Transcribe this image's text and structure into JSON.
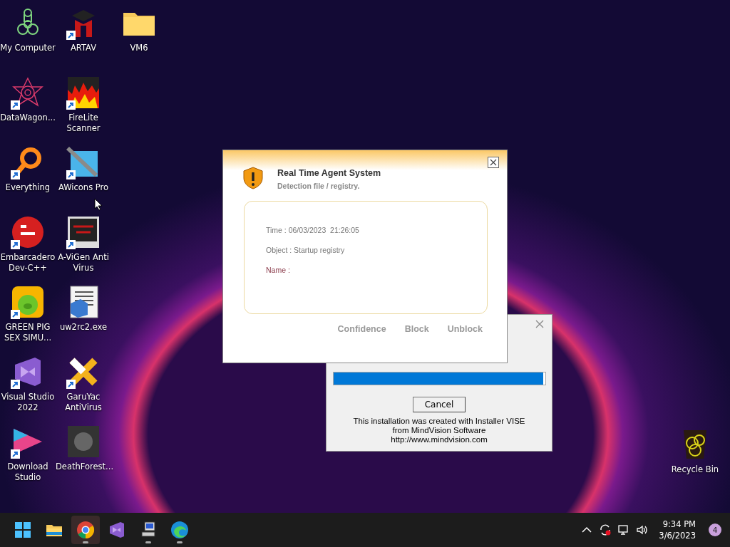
{
  "desktop_icons": [
    {
      "label": "My Computer",
      "kind": "computer",
      "shortcut": false
    },
    {
      "label": "DataWagon...",
      "kind": "star",
      "shortcut": true
    },
    {
      "label": "Everything",
      "kind": "magnifier",
      "shortcut": true
    },
    {
      "label": "Embarcadero Dev-C++",
      "kind": "devcpp",
      "shortcut": true
    },
    {
      "label": "GREEN PIG SEX SIMU...",
      "kind": "pig",
      "shortcut": true
    },
    {
      "label": "Visual Studio 2022",
      "kind": "vs",
      "shortcut": true
    },
    {
      "label": "Download Studio",
      "kind": "ds",
      "shortcut": true
    },
    {
      "label": "ARTAV",
      "kind": "cap",
      "shortcut": true
    },
    {
      "label": "FireLite Scanner",
      "kind": "fire",
      "shortcut": true
    },
    {
      "label": "AWicons Pro",
      "kind": "pen",
      "shortcut": true
    },
    {
      "label": "A-ViGen Anti Virus",
      "kind": "monitor",
      "shortcut": true
    },
    {
      "label": "uw2rc2.exe",
      "kind": "binary",
      "shortcut": false
    },
    {
      "label": "GaruYac AntiVirus",
      "kind": "cross",
      "shortcut": true
    },
    {
      "label": "DeathForest...",
      "kind": "photo",
      "shortcut": false
    },
    {
      "label": "VM6",
      "kind": "folder",
      "shortcut": false
    }
  ],
  "recycle_bin": {
    "label": "Recycle Bin"
  },
  "alert_dialog": {
    "title": "Real Time Agent System",
    "subtitle": "Detection file / registry.",
    "fields": [
      {
        "text": "Time : 06/03/2023  21:26:05",
        "kind": "plain"
      },
      {
        "text": "Object : Startup registry",
        "kind": "plain"
      },
      {
        "text": "Name :",
        "kind": "highlight"
      }
    ],
    "buttons": [
      "Confidence",
      "Block",
      "Unblock"
    ]
  },
  "installer": {
    "level": 0.99,
    "button": "Cancel",
    "credit": [
      "This installation was created with Installer VISE",
      "from MindVision Software",
      "http://www.mindvision.com"
    ]
  },
  "taskbar": {
    "apps": [
      {
        "kind": "start",
        "selected": false,
        "running": false
      },
      {
        "kind": "explorer",
        "selected": false,
        "running": false
      },
      {
        "kind": "chrome",
        "selected": true,
        "running": true
      },
      {
        "kind": "vs",
        "selected": false,
        "running": false
      },
      {
        "kind": "setup",
        "selected": false,
        "running": true
      },
      {
        "kind": "edge",
        "selected": false,
        "running": true
      }
    ],
    "time": "9:34 PM",
    "date": "3/6/2023",
    "notifications": "4"
  }
}
